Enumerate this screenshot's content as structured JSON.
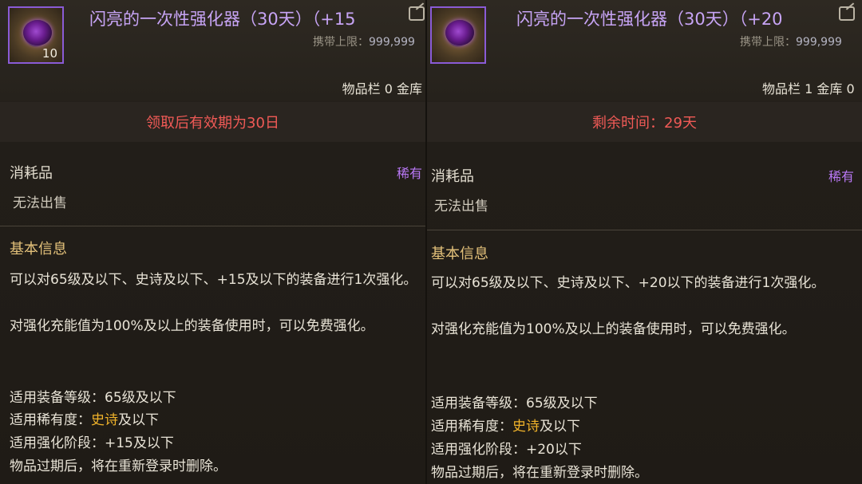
{
  "left": {
    "title": "闪亮的一次性强化器（30天）（+15",
    "count": "10",
    "limit_label": "携带上限：",
    "limit_value": "999,999",
    "inventory": "物品栏 0 金库",
    "notice": "领取后有效期为30日",
    "category": "消耗品",
    "rarity": "稀有",
    "sell": "无法出售",
    "section": "基本信息",
    "desc_1": "可以对65级及以下、史诗及以下、+15及以下的装备进行1次强化。",
    "desc_2": "对强化充能值为100%及以上的装备使用时，可以免费强化。",
    "level_line": "适用装备等级：65级及以下",
    "rarity_prefix": "适用稀有度：",
    "rarity_epic": "史诗",
    "rarity_suffix": "及以下",
    "stage_line": "适用强化阶段：+15及以下",
    "expire_line": "物品过期后，将在重新登录时删除。"
  },
  "right": {
    "title": "闪亮的一次性强化器（30天）（+20",
    "limit_label": "携带上限：",
    "limit_value": "999,999",
    "inventory": "物品栏 1 金库 0",
    "notice": "剩余时间：29天",
    "category": "消耗品",
    "rarity": "稀有",
    "sell": "无法出售",
    "section": "基本信息",
    "desc_1": "可以对65级及以下、史诗及以下、+20以下的装备进行1次强化。",
    "desc_2": "对强化充能值为100%及以上的装备使用时，可以免费强化。",
    "level_line": "适用装备等级：65级及以下",
    "rarity_prefix": "适用稀有度：",
    "rarity_epic": "史诗",
    "rarity_suffix": "及以下",
    "stage_line": "适用强化阶段：+20以下",
    "expire_line": "物品过期后，将在重新登录时删除。"
  },
  "colors": {
    "title": "#c7a4f5",
    "notice": "#f05a56",
    "rarity": "#b978f5",
    "section": "#e3c17a",
    "epic": "#f0b32a"
  },
  "icons": {
    "item": "enhancer-disc-icon",
    "edit": "edit-icon"
  }
}
